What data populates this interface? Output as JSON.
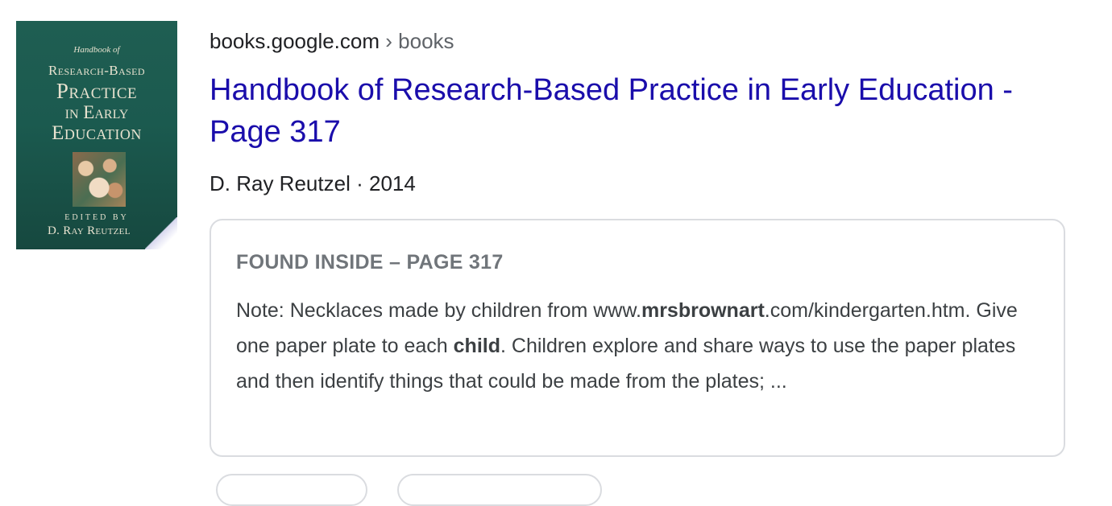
{
  "cover": {
    "line1": "Handbook of",
    "line2": "Research-Based",
    "line3": "Practice",
    "line4": "in Early",
    "line5": "Education",
    "edited_by": "EDITED BY",
    "author": "D. Ray Reutzel"
  },
  "result": {
    "site": "books.google.com",
    "separator": "›",
    "path": "books",
    "title": "Handbook of Research-Based Practice in Early Education - Page 317",
    "author": "D. Ray Reutzel",
    "dot": "·",
    "year": "2014"
  },
  "found_inside": {
    "heading": "FOUND INSIDE – PAGE 317",
    "text_1": "Note: Necklaces made by children from www.",
    "bold_1": "mrsbrownart",
    "text_2": ".com/kindergarten.htm. Give one paper plate to each ",
    "bold_2": "child",
    "text_3": ". Children explore and share ways to use the paper plates and then identify things that could be made from the plates; ..."
  },
  "colors": {
    "link": "#1a0dab",
    "text": "#202124",
    "muted": "#5f6368",
    "border": "#dadce0",
    "cover": "#1b5a4f"
  }
}
